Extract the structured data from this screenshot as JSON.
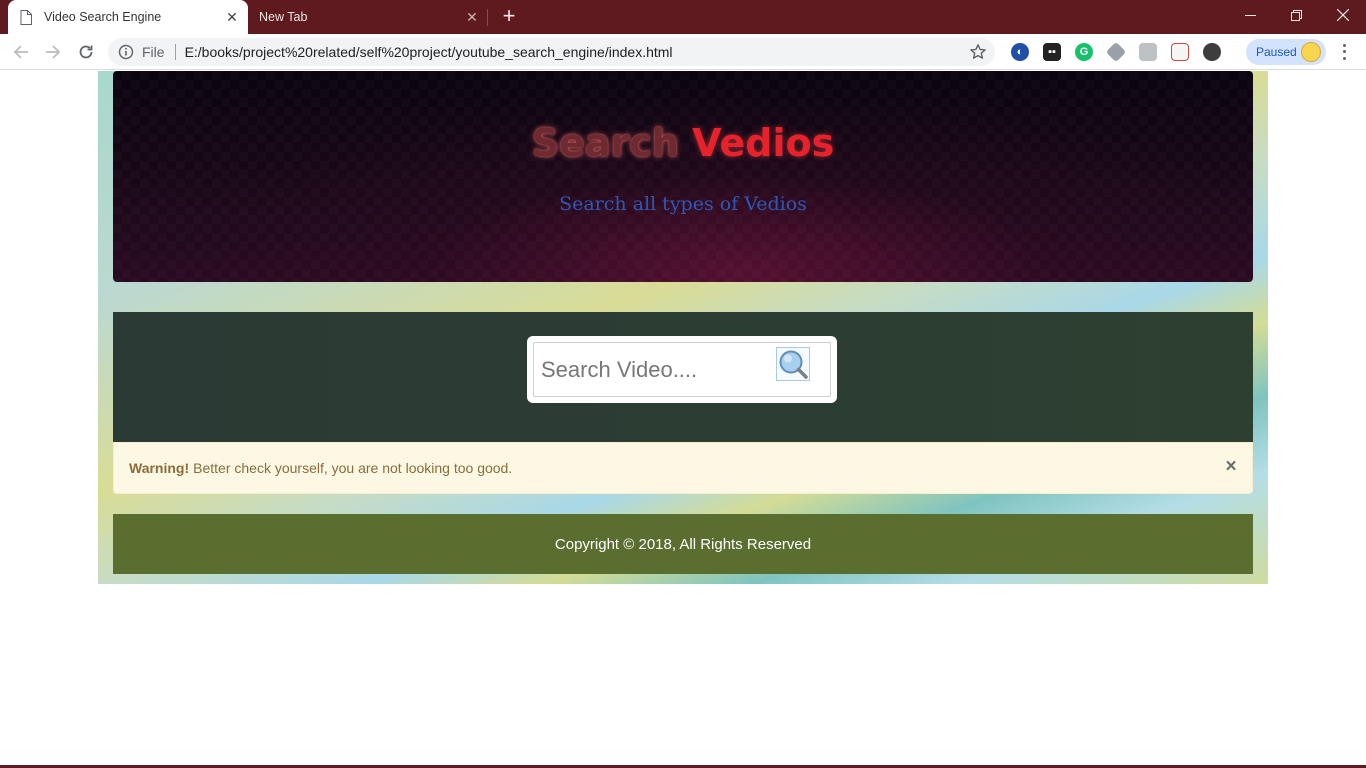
{
  "browser": {
    "tabs": [
      {
        "label": "Video Search Engine",
        "active": true
      },
      {
        "label": "New Tab",
        "active": false
      }
    ],
    "address": {
      "scheme_label": "File",
      "url": "E:/books/project%20related/self%20project/youtube_search_engine/index.html"
    },
    "profile_status": "Paused",
    "colors": {
      "frame": "#5e1a1e",
      "omnibox": "#f1f3f4"
    }
  },
  "page": {
    "header": {
      "title_part1": "Search",
      "title_part2": "Vedios",
      "subtitle": "Search all types of Vedios"
    },
    "search": {
      "placeholder": "Search Video...."
    },
    "alert": {
      "strong": "Warning!",
      "message": "Better check yourself, you are not looking too good.",
      "close": "×"
    },
    "footer": {
      "copyright": "Copyright © 2018, All Rights Reserved"
    },
    "colors": {
      "alert_bg": "#fcf8e3",
      "alert_text": "#8a6d3b",
      "footer_bg": "#5a6e30",
      "search_section_bg": "#2c3d34",
      "subtitle_text": "#2e58b8"
    }
  }
}
